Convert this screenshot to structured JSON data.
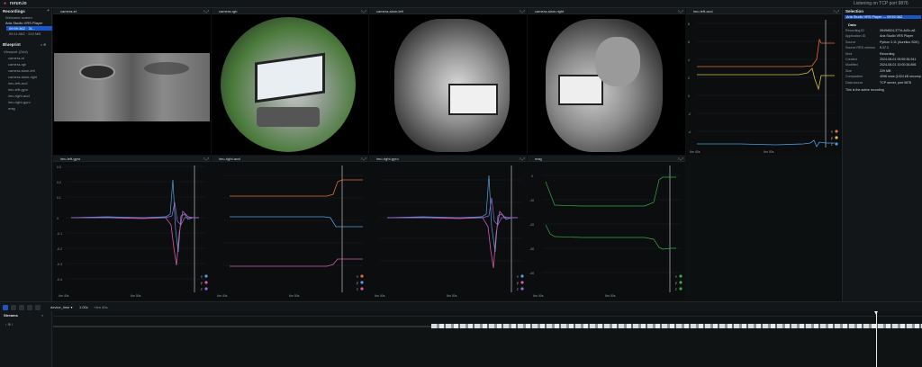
{
  "app": {
    "title": "rerun.io",
    "status": "Listening on TCP port 9876"
  },
  "recordings": {
    "header": "Recordings",
    "items": [
      "Welcome screen",
      "Aria Studio VRS Player",
      "09:59:36Z · 31...",
      "09:11:06Z · 210 MB"
    ]
  },
  "blueprint": {
    "header": "Blueprint",
    "items": [
      "Viewport (Grid)",
      "camera-et",
      "camera-rgb",
      "camera-slam-left",
      "camera-slam-right",
      "imu-left-accl",
      "imu-left-gyro",
      "imu-right-accl",
      "imu-right-gyro",
      "mag"
    ]
  },
  "views": {
    "camera_et": "camera-et",
    "camera_rgb": "camera-rgb",
    "camera_slam_left": "camera-slam-left",
    "camera_slam_right": "camera-slam-right",
    "imu_left_accl": "imu-left-accl",
    "imu_left_gyro": "imu-left-gyro",
    "imu_right_accl": "imu-right-accl",
    "imu_right_gyro": "imu-right-gyro",
    "mag": "mag"
  },
  "selection": {
    "header": "Selection",
    "selected": "Aria Studio VRS Player — 09:59:36Z",
    "data_header": "Data",
    "rows": [
      {
        "k": "Recording ID",
        "v": "0649d524-377d-4d2c-a8"
      },
      {
        "k": "Application ID",
        "v": "Aria Studio VRS Player"
      },
      {
        "k": "Source",
        "v": "Python 3.11 (Aurelius SDK)"
      },
      {
        "k": "Source RRD version",
        "v": "0.17.1"
      },
      {
        "k": "Kind",
        "v": "Recording"
      },
      {
        "k": "Created",
        "v": "2024-08-01 09:59:36.941"
      },
      {
        "k": "Modified",
        "v": "2024-08-01 10:00:36.856"
      },
      {
        "k": "Size",
        "v": "229 MB"
      },
      {
        "k": "Compaction",
        "v": "4096 rows (1024 kB uncomp..."
      },
      {
        "k": "Data source",
        "v": "TCP server, port 9876"
      }
    ],
    "active_note": "This is the active recording"
  },
  "timeline": {
    "timeline_name": "device_time",
    "speed": "1.00x",
    "cursor": "+4m 40s",
    "streams_label": "Streams",
    "root": "/"
  },
  "axes": {
    "top_x": [
      "6m 40s",
      "6m 50s"
    ],
    "left_x": [
      "6m 40s",
      "6m 50s"
    ],
    "accl_left_y": [
      "8",
      "6",
      "4",
      "2",
      "0",
      "-2",
      "-4",
      "-6",
      "-8",
      "-10",
      "-12",
      "-14"
    ],
    "gyro_y": [
      "0.3",
      "0.2",
      "0.1",
      "0",
      "-0.1",
      "-0.2",
      "-0.3",
      "-0.4",
      "-0.5"
    ],
    "mag_y": [
      "0",
      "-10",
      "-20",
      "-30",
      "-40"
    ]
  },
  "legend": [
    "x",
    "y",
    "z"
  ],
  "colors": {
    "x": "#e86b3a",
    "y": "#d8c24a",
    "z": "#4a9fd8",
    "gyro_x": "#5aa0d8",
    "gyro_y": "#d85aa8",
    "gyro_z": "#9a6bd8",
    "mag": "#3aa84a",
    "accent": "#1a56c5"
  }
}
